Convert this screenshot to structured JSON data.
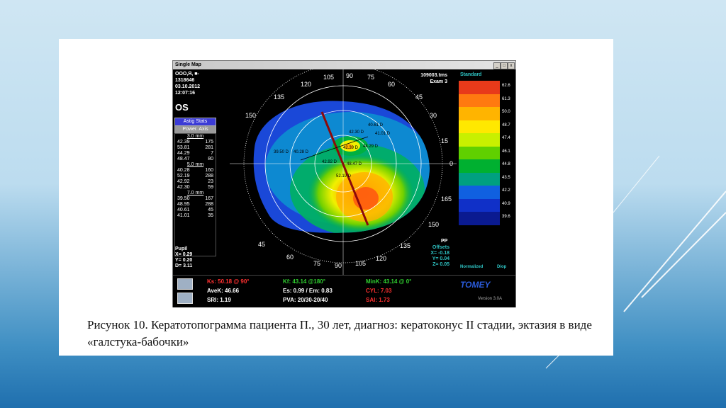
{
  "window": {
    "title": "Single Map",
    "buttons": [
      "_",
      "□",
      "x"
    ]
  },
  "patient": {
    "name": "ООО,Я, ■-",
    "id": "1318646",
    "date": "03.10.2012",
    "time": "12:07:16",
    "eye": "OS"
  },
  "file": {
    "name": "109003.tms",
    "exam": "Exam 3"
  },
  "buttons": {
    "astig": "Astig Stats",
    "power": "Power. Axis"
  },
  "zones": [
    {
      "header": "3.0 mm",
      "rows": [
        [
          "42.39",
          "175"
        ],
        [
          "53.81",
          "281"
        ],
        [
          "44.29",
          "7"
        ],
        [
          "48.47",
          "80"
        ]
      ]
    },
    {
      "header": "5.0 mm",
      "rows": [
        [
          "40.28",
          "160"
        ],
        [
          "52.19",
          "288"
        ],
        [
          "42.92",
          "23"
        ],
        [
          "42.30",
          "59"
        ]
      ]
    },
    {
      "header": "7.0 mm",
      "rows": [
        [
          "39.50",
          "167"
        ],
        [
          "48.95",
          "288"
        ],
        [
          "40.61",
          "45"
        ],
        [
          "41.01",
          "35"
        ]
      ]
    }
  ],
  "angles": [
    "105",
    "90",
    "75",
    "120",
    "60",
    "135",
    "45",
    "150",
    "30",
    "15",
    "0",
    "165",
    "150",
    "135",
    "120",
    "105",
    "90",
    "75",
    "60",
    "45"
  ],
  "map_labels": [
    "40.61 D",
    "42.30 D",
    "41.01 D",
    "39.50 D",
    "40.28 D",
    "42.39 D",
    "44.29 D",
    "42.92 D",
    "48.47 D",
    "52.19 D"
  ],
  "pupil": {
    "title": "Pupil",
    "x": "X= 0.29",
    "y": "Y= 0.20",
    "d": "D= 3.11"
  },
  "pp": "PP",
  "offsets": {
    "title": "Offsets",
    "x": "X= -0.18",
    "y": "Y= 0.04",
    "z": "Z= 0.05"
  },
  "scale": {
    "title": "Standard",
    "foot_left": "Normalized",
    "foot_right": "Diop",
    "values": [
      "62.6",
      "61.3",
      "50.0",
      "48.7",
      "47.4",
      "46.1",
      "44.8",
      "43.5",
      "42.2",
      "40.9",
      "39.6"
    ],
    "colors": [
      "#e83a1a",
      "#ff7a10",
      "#ffb400",
      "#ffe800",
      "#c8f000",
      "#60d000",
      "#00b030",
      "#00a080",
      "#1060e0",
      "#1030c8",
      "#0a1a90"
    ]
  },
  "bottom": {
    "ks": "Ks: 50.18 @ 90°",
    "kf": "Kf: 43.14 @180°",
    "mink": "MinK: 43.14 @ 0°",
    "avek": "AveK: 46.66",
    "es": "Es: 0.99 / Em: 0.83",
    "cyl": "CYL: 7.03",
    "sri": "SRI: 1.19",
    "pva": "PVA: 20/30-20/40",
    "sai": "SAI: 1.73",
    "brand": "TOMEY",
    "version": "Version 3.0A"
  },
  "caption": "Рисунок 10. Кератотопограмма пациента П., 30 лет, диагноз: кератоконус II стадии, эктазия в виде «галстука-бабочки»"
}
